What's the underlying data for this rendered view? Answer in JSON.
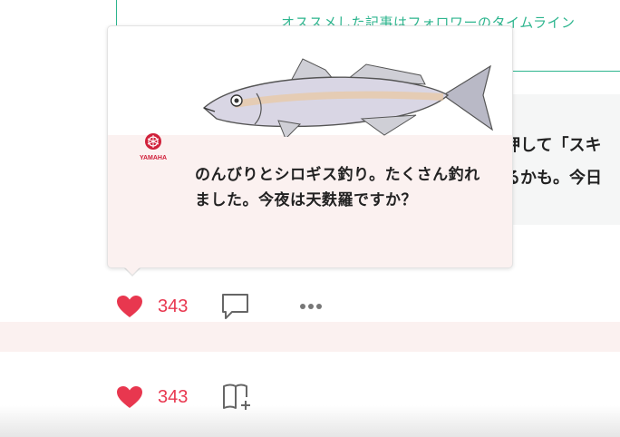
{
  "background": {
    "recommend_text": "オススメした記事はフォロワーのタイムライン",
    "grey_line1": "押して「スキ",
    "grey_line2": "るかも。今日"
  },
  "popover": {
    "logo_text": "YAMAHA",
    "caption": "のんびりとシロギス釣り。たくさん釣れました。今夜は天麩羅ですか？"
  },
  "actions_row1": {
    "like_count": "343"
  },
  "actions_row2": {
    "like_count": "343"
  },
  "colors": {
    "accent_red": "#e8374f",
    "accent_green": "#2db58e",
    "pink_bg": "#fbf1f0"
  }
}
